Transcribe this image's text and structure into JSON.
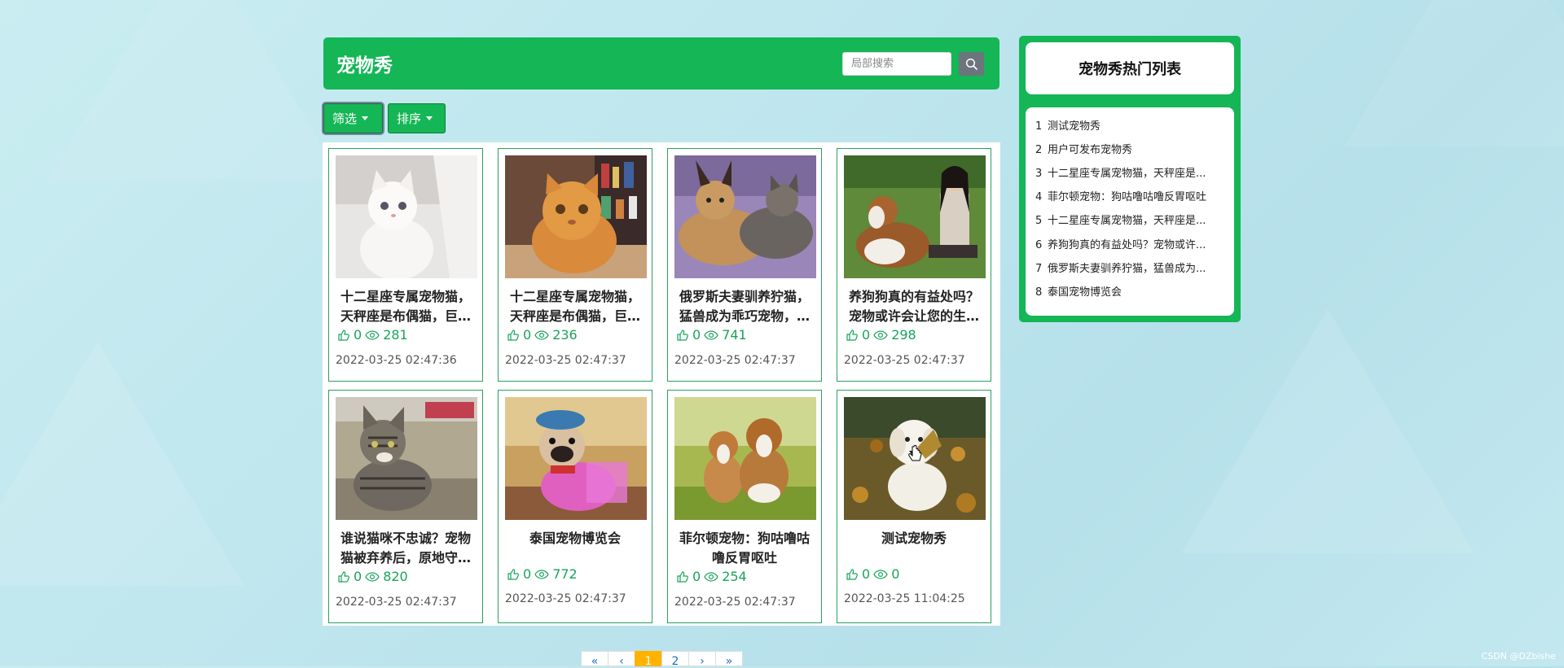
{
  "header": {
    "title": "宠物秀",
    "search_placeholder": "局部搜索"
  },
  "toolbar": {
    "filter_label": "筛选",
    "sort_label": "排序"
  },
  "cards": [
    {
      "title": "十二星座专属宠物猫，天秤座是布偶猫，巨…",
      "likes": "0",
      "views": "281",
      "date": "2022-03-25 02:47:36",
      "image": "white-kitten"
    },
    {
      "title": "十二星座专属宠物猫，天秤座是布偶猫，巨…",
      "likes": "0",
      "views": "236",
      "date": "2022-03-25 02:47:37",
      "image": "orange-exotic-cat"
    },
    {
      "title": "俄罗斯夫妻驯养狞猫，猛兽成为乖巧宠物，…",
      "likes": "0",
      "views": "741",
      "date": "2022-03-25 02:47:37",
      "image": "caracal-and-cat"
    },
    {
      "title": "养狗狗真的有益处吗？宠物或许会让您的生…",
      "likes": "0",
      "views": "298",
      "date": "2022-03-25 02:47:37",
      "image": "collie-and-girl"
    },
    {
      "title": "谁说猫咪不忠诚？宠物猫被弃养后，原地守…",
      "likes": "0",
      "views": "820",
      "date": "2022-03-25 02:47:37",
      "image": "tabby-cat"
    },
    {
      "title": "泰国宠物博览会",
      "likes": "0",
      "views": "772",
      "date": "2022-03-25 02:47:37",
      "image": "dressed-pug"
    },
    {
      "title": "菲尔顿宠物：狗咕噜咕噜反胃呕吐",
      "likes": "0",
      "views": "254",
      "date": "2022-03-25 02:47:37",
      "image": "beagle-puppies"
    },
    {
      "title": "测试宠物秀",
      "likes": "0",
      "views": "0",
      "date": "2022-03-25 11:04:25",
      "image": "white-puppy-leaves"
    }
  ],
  "sidebar": {
    "title": "宠物秀热门列表",
    "items": [
      {
        "num": "1",
        "label": "测试宠物秀"
      },
      {
        "num": "2",
        "label": "用户可发布宠物秀"
      },
      {
        "num": "3",
        "label": "十二星座专属宠物猫，天秤座是..."
      },
      {
        "num": "4",
        "label": "菲尔顿宠物：狗咕噜咕噜反胃呕吐"
      },
      {
        "num": "5",
        "label": "十二星座专属宠物猫，天秤座是..."
      },
      {
        "num": "6",
        "label": "养狗狗真的有益处吗？宠物或许..."
      },
      {
        "num": "7",
        "label": "俄罗斯夫妻驯养狞猫，猛兽成为..."
      },
      {
        "num": "8",
        "label": "泰国宠物博览会"
      }
    ]
  },
  "pagination": {
    "first": "«",
    "prev": "‹",
    "page1": "1",
    "page2": "2",
    "next": "›",
    "last": "»"
  },
  "watermark": "CSDN @DZbishe",
  "colors": {
    "brand": "#14b655",
    "accent": "#ffb300"
  }
}
